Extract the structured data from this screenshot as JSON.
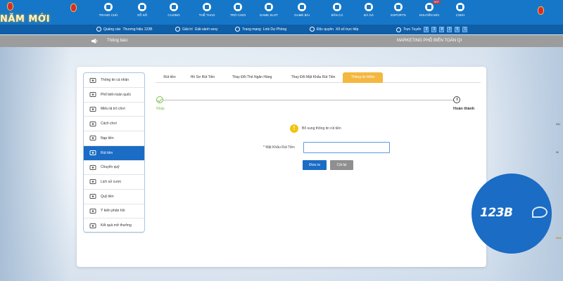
{
  "brand": {
    "banner_text": "NĂM MỚI"
  },
  "nav": {
    "items": [
      {
        "label": "TRANG CHỦ",
        "icon": "home-icon"
      },
      {
        "label": "XỔ SỐ",
        "icon": "lottery-icon"
      },
      {
        "label": "CASINO",
        "icon": "casino-icon"
      },
      {
        "label": "THỂ THAO",
        "icon": "soccer-icon"
      },
      {
        "label": "TRÒ CHƠI",
        "icon": "chess-icon"
      },
      {
        "label": "GAME SLOT",
        "icon": "slot-icon"
      },
      {
        "label": "GAME BÀI",
        "icon": "cards-icon"
      },
      {
        "label": "BẮN CÁ",
        "icon": "fish-icon"
      },
      {
        "label": "ĐÁ GÀ",
        "icon": "rooster-icon"
      },
      {
        "label": "ESPORTS",
        "icon": "gamepad-icon"
      },
      {
        "label": "KHUYẾN MÃI",
        "icon": "gift-icon",
        "badge": "HOT"
      },
      {
        "label": "CSKH",
        "icon": "support-icon"
      }
    ]
  },
  "subbar": {
    "items": [
      {
        "prefix": "Quảng cáo",
        "value": "Thương hiệu 123B"
      },
      {
        "prefix": "Giải trí",
        "value": "Giải sành sexy"
      },
      {
        "prefix": "Trang mạng",
        "value": "Link Dự Phòng"
      },
      {
        "prefix": "Độc quyền",
        "value": "Xổ số trực tiếp"
      }
    ],
    "online_label": "Trực Tuyến",
    "online_digits": [
      "3",
      "3",
      "8",
      "2",
      "5",
      "1"
    ]
  },
  "notice": {
    "label": "Thông báo:",
    "marquee": "MARKETING PHỔ BIẾN TOÀN QI"
  },
  "sidebar": {
    "items": [
      {
        "label": "Thông tin cá nhân",
        "icon": "id-card-icon"
      },
      {
        "label": "Phổ biến toàn quốc",
        "icon": "diamond-icon"
      },
      {
        "label": "Miêu tả trò chơi",
        "icon": "gamepad-icon"
      },
      {
        "label": "Cách chơi",
        "icon": "info-icon"
      },
      {
        "label": "Nạp tiền",
        "icon": "piggy-bank-icon"
      },
      {
        "label": "Rút tiền",
        "icon": "bank-icon",
        "active": true
      },
      {
        "label": "Chuyển quỹ",
        "icon": "transfer-icon"
      },
      {
        "label": "Lịch sử cược",
        "icon": "history-icon"
      },
      {
        "label": "Quỹ tiền",
        "icon": "money-icon"
      },
      {
        "label": "Ý kiến phản hồi",
        "icon": "chat-icon"
      },
      {
        "label": "Kết quả mở thưởng",
        "icon": "result-icon"
      }
    ]
  },
  "tabs": [
    {
      "label": "Rút tiền"
    },
    {
      "label": "Hồ Sơ Rút Tiền"
    },
    {
      "label": "Thay Đổi Thẻ Ngân Hàng"
    },
    {
      "label": "Thay Đổi Mật Khẩu Rút Tiền"
    },
    {
      "label": "Thông tin thêm",
      "active": true
    }
  ],
  "stepper": {
    "start_label": "Nhập",
    "end_label": "Hoàn thành"
  },
  "form": {
    "info_text": "Bổ sung thông tin rút tiền",
    "password_label": "* Mật Khẩu Rút Tiền",
    "password_value": "",
    "submit_label": "Đưa ra",
    "reset_label": "Cài lại"
  },
  "logo": {
    "text": "123B"
  },
  "peek": {
    "top": "HU",
    "mid": "W",
    "promo": "Nhậ"
  },
  "colors": {
    "nav_bg": "#1677c9",
    "subbar_bg": "#0f5ea8",
    "notice_bg": "#9c9c9c",
    "active_blue": "#1a6cc4",
    "tab_active": "#f4b740",
    "step_done": "#7cc04e",
    "info_yellow": "#f1c40f",
    "reset_gray": "#8f8f8f"
  }
}
